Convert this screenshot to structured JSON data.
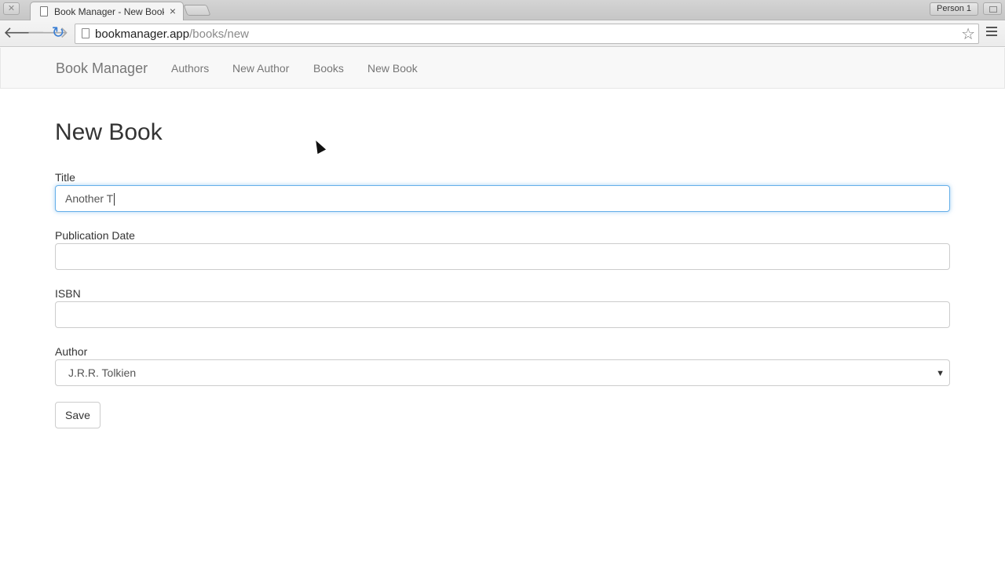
{
  "browser": {
    "tab_title": "Book Manager - New Book",
    "tab_close": "×",
    "profile": "Person 1",
    "url_host": "bookmanager.app",
    "url_path": "/books/new",
    "icons": [
      "back-arrow-icon",
      "forward-arrow-icon",
      "reload-icon",
      "page-icon",
      "star-icon",
      "menu-icon"
    ]
  },
  "navbar": {
    "brand": "Book Manager",
    "links": [
      "Authors",
      "New Author",
      "Books",
      "New Book"
    ]
  },
  "page": {
    "title": "New Book"
  },
  "form": {
    "title_label": "Title",
    "title_value": "Another T",
    "date_label": "Publication Date",
    "date_value": "",
    "isbn_label": "ISBN",
    "isbn_value": "",
    "author_label": "Author",
    "author_selected": "J.R.R. Tolkien",
    "save_label": "Save"
  },
  "colors": {
    "focus_border": "#66afe9",
    "reload": "#3b7fd4"
  }
}
